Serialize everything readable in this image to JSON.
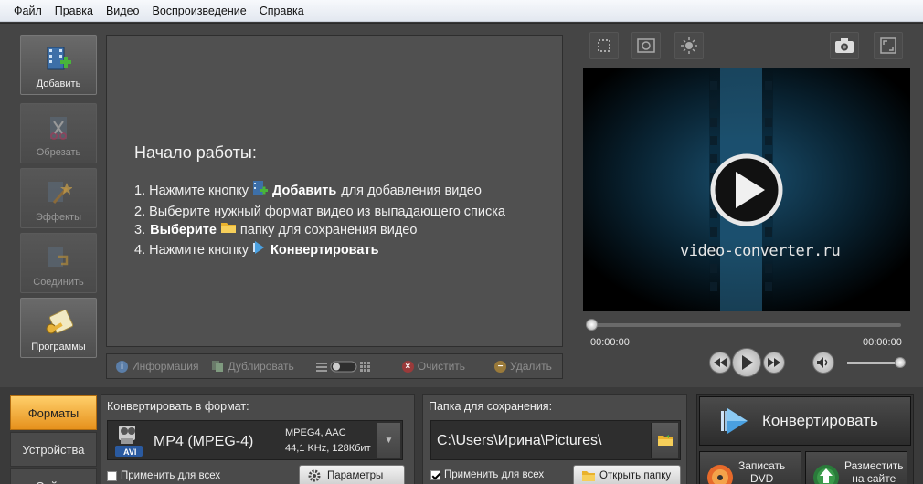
{
  "menu": [
    "Файл",
    "Правка",
    "Видео",
    "Воспроизведение",
    "Справка"
  ],
  "tools": {
    "add": "Добавить",
    "cut": "Обрезать",
    "effects": "Эффекты",
    "join": "Соединить",
    "programs": "Программы"
  },
  "start": {
    "title": "Начало работы:",
    "step1_prefix": "1. Нажмите кнопку",
    "step1_bold": "Добавить",
    "step1_suffix": "для добавления видео",
    "step2": "2. Выберите нужный формат видео из выпадающего списка",
    "step3_prefix": "3.",
    "step3_bold": "Выберите",
    "step3_suffix": "папку для сохранения видео",
    "step4_prefix": "4. Нажмите кнопку",
    "step4_bold": "Конвертировать"
  },
  "listbar": {
    "info": "Информация",
    "duplicate": "Дублировать",
    "clear": "Очистить",
    "delete": "Удалить"
  },
  "preview": {
    "watermark": "video-converter.ru",
    "time_current": "00:00:00",
    "time_total": "00:00:00"
  },
  "tabs": {
    "formats": "Форматы",
    "devices": "Устройства",
    "sites": "Сайты"
  },
  "format": {
    "title": "Конвертировать в формат:",
    "name": "MP4 (MPEG-4)",
    "badge": "AVI",
    "codec": "MPEG4, AAC",
    "params": "44,1 KHz, 128Кбит",
    "apply_all": "Применить для всех",
    "settings_button": "Параметры"
  },
  "save": {
    "title": "Папка для сохранения:",
    "path": "C:\\Users\\Ирина\\Pictures\\",
    "apply_all": "Применить для всех",
    "open_folder": "Открыть папку"
  },
  "convert": {
    "main": "Конвертировать",
    "dvd_line1": "Записать",
    "dvd_line2": "DVD",
    "web_line1": "Разместить",
    "web_line2": "на сайте"
  }
}
